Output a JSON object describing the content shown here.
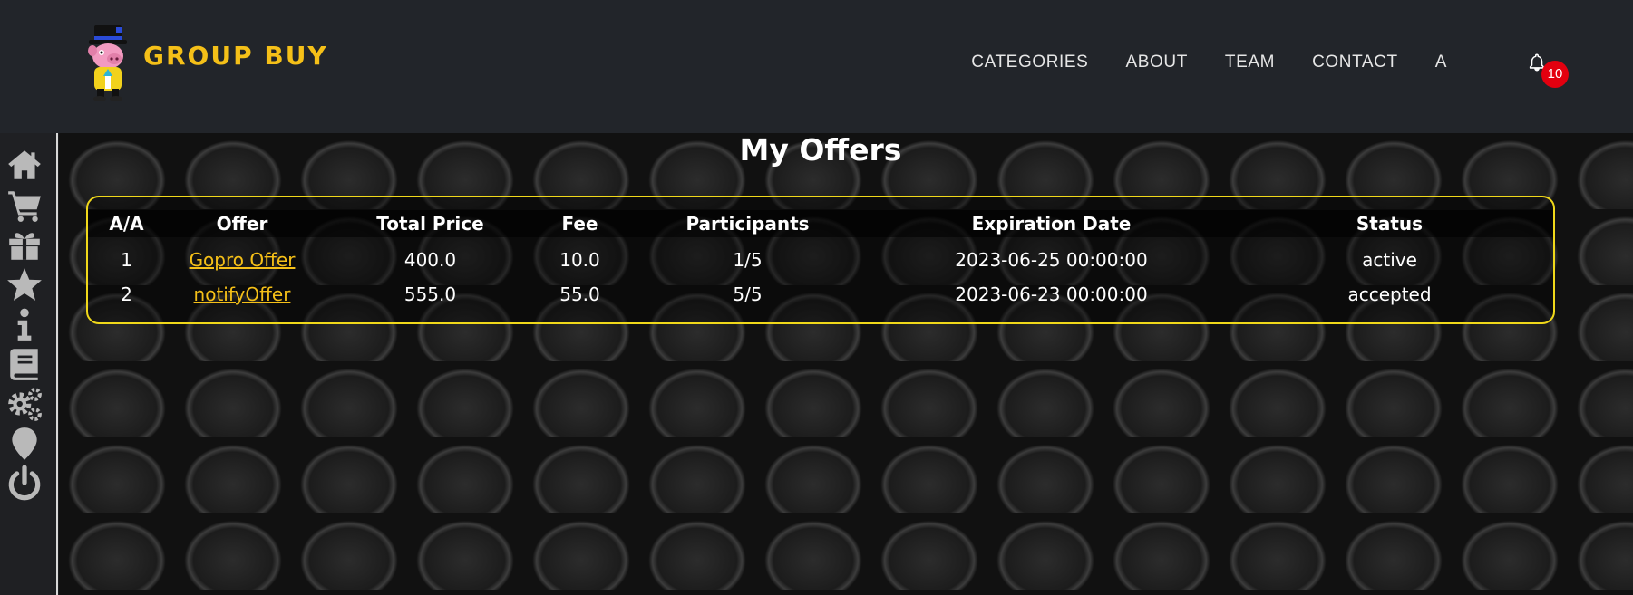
{
  "brand": {
    "name": "GROUP BUY",
    "logo_icon": "pig-mascot-logo",
    "color": "#f5c018"
  },
  "nav": {
    "items": [
      {
        "label": "CATEGORIES"
      },
      {
        "label": "ABOUT"
      },
      {
        "label": "TEAM"
      },
      {
        "label": "CONTACT"
      },
      {
        "label": "A"
      }
    ],
    "notification_count": "10"
  },
  "sidebar": {
    "icons": [
      "home-icon",
      "cart-icon",
      "gift-icon",
      "star-icon",
      "info-icon",
      "book-icon",
      "gears-icon",
      "map-marker-icon",
      "power-icon"
    ]
  },
  "main": {
    "title": "My Offers",
    "table": {
      "headers": [
        "A/A",
        "Offer",
        "Total Price",
        "Fee",
        "Participants",
        "Expiration Date",
        "Status"
      ],
      "rows": [
        {
          "aa": "1",
          "offer": "Gopro Offer",
          "total_price": "400.0",
          "fee": "10.0",
          "participants": "1/5",
          "expiration": "2023-06-25 00:00:00",
          "status": "active"
        },
        {
          "aa": "2",
          "offer": "notifyOffer",
          "total_price": "555.0",
          "fee": "55.0",
          "participants": "5/5",
          "expiration": "2023-06-23 00:00:00",
          "status": "accepted"
        }
      ]
    }
  },
  "colors": {
    "navbar_bg": "#22252a",
    "accent": "#f5c018",
    "table_border": "#f0d81a",
    "badge": "#e3000f"
  }
}
